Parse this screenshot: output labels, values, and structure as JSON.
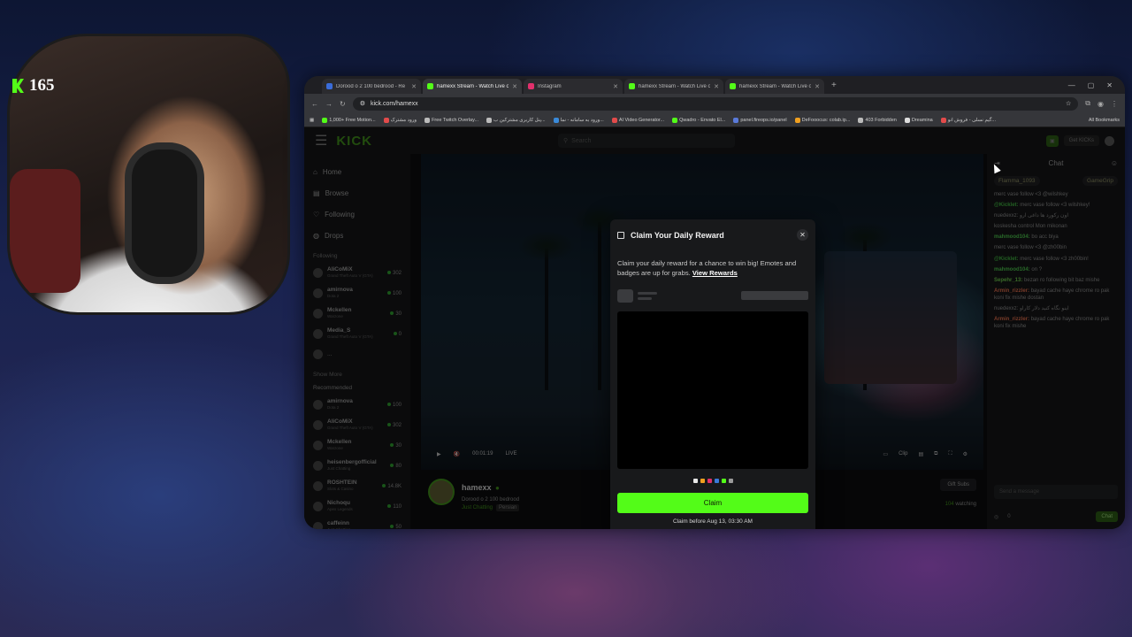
{
  "overlay": {
    "counter_value": "165",
    "counter_color": "#53fc18"
  },
  "browser": {
    "tabs": [
      {
        "title": "Dorood o 2 100 bedrood - Re",
        "fav": "#3a6cd9"
      },
      {
        "title": "hamexx Stream - Watch Live o",
        "fav": "#53fc18",
        "active": true
      },
      {
        "title": "Instagram",
        "fav": "#e1306c"
      },
      {
        "title": "hamexx Stream - Watch Live o",
        "fav": "#53fc18"
      },
      {
        "title": "hamexx Stream - Watch Live o",
        "fav": "#53fc18"
      }
    ],
    "url": "kick.com/hamexx",
    "bookmarks": [
      {
        "label": "1,000+ Free Motion...",
        "fav": "#53fc18"
      },
      {
        "label": "ورود مشترک",
        "fav": "#e24b4b"
      },
      {
        "label": "Free Twitch Overlay...",
        "fav": "#bbb"
      },
      {
        "label": "پنل کاربری مشترکین ب...",
        "fav": "#bbb"
      },
      {
        "label": "ورود به سامانه - نما...",
        "fav": "#3a8ad9"
      },
      {
        "label": "AI Video Generator...",
        "fav": "#e24b4b"
      },
      {
        "label": "Qwadro - Envato El...",
        "fav": "#53fc18"
      },
      {
        "label": "panel.fireops.io/panel",
        "fav": "#5a7ad9"
      },
      {
        "label": "DeFooocus: colab.ip...",
        "fav": "#f0a020"
      },
      {
        "label": "403 Forbidden",
        "fav": "#bbb"
      },
      {
        "label": "Dreamina",
        "fav": "#ddd"
      },
      {
        "label": "گیم نسلی - فروش انو...",
        "fav": "#e24b4b"
      }
    ],
    "all_bookmarks": "All Bookmarks"
  },
  "kick": {
    "logo": "KICK",
    "search_placeholder": "Search",
    "get_kicks": "Get KICKs",
    "nav": [
      {
        "label": "Home",
        "icon": "home-icon",
        "glyph": "⌂"
      },
      {
        "label": "Browse",
        "icon": "browse-icon",
        "glyph": "▤"
      },
      {
        "label": "Following",
        "icon": "heart-icon",
        "glyph": "♡"
      },
      {
        "label": "Drops",
        "icon": "drops-icon",
        "glyph": "◍"
      }
    ],
    "following_header": "Following",
    "following": [
      {
        "name": "AliCoMiX",
        "sub": "Grand Theft Auto V (GTA)",
        "viewers": "302"
      },
      {
        "name": "amirnova",
        "sub": "Dota 2",
        "viewers": "100"
      },
      {
        "name": "Mckellen",
        "sub": "Warzone",
        "viewers": "30"
      },
      {
        "name": "Media_S",
        "sub": "Grand Theft Auto V (GTA)",
        "viewers": "0"
      }
    ],
    "show_more": "Show More",
    "recommended_header": "Recommended",
    "recommended": [
      {
        "name": "amirnova",
        "sub": "Dota 2",
        "viewers": "100"
      },
      {
        "name": "AliCoMiX",
        "sub": "Grand Theft Auto V (GTA)",
        "viewers": "302"
      },
      {
        "name": "Mckellen",
        "sub": "Warzone",
        "viewers": "30"
      },
      {
        "name": "heisenbergofficial",
        "sub": "Just Chatting",
        "viewers": "80"
      },
      {
        "name": "ROSHTEIN",
        "sub": "Slots & Casino",
        "viewers": "14.8K"
      },
      {
        "name": "Nichoqu",
        "sub": "Apex Legends",
        "viewers": "110"
      },
      {
        "name": "caffeinn",
        "sub": "Just Chatting",
        "viewers": "50"
      }
    ],
    "player": {
      "time": "00:01:19",
      "live": "LIVE",
      "clip": "Clip"
    },
    "streamer": {
      "name": "hamexx",
      "title": "Dorood o 2 100 bedrood",
      "category": "Just Chatting",
      "tag": "Persian",
      "gift_subs": "Gift Subs",
      "watching_count": "104",
      "watching_label": "watching"
    },
    "chat": {
      "title": "Chat",
      "gifters": [
        "Flamma_1093",
        "GameGrip"
      ],
      "messages": [
        {
          "user": "",
          "text": "merc vase follow <3 @wilshkey",
          "color": "#d94a4a"
        },
        {
          "user": "@Kicklet:",
          "text": "merc vase follow <3 wilshkey!",
          "color": "#3fae3f"
        },
        {
          "user": "",
          "text": "nuedexxz: اون رکورد ها داغی ارو",
          "color": "#8a8a8a"
        },
        {
          "user": "",
          "text": "koskesha control Mon mikonan",
          "color": "#d94a4a"
        },
        {
          "user": "mahmood104:",
          "text": "bo acc biya",
          "color": "#4abf4a"
        },
        {
          "user": "",
          "text": "merc vase follow <3 @zh00bin",
          "color": "#d94a4a"
        },
        {
          "user": "@Kicklet:",
          "text": "merc vase follow <3 zh00bin!",
          "color": "#3fae3f"
        },
        {
          "user": "mahmood104:",
          "text": "on ?",
          "color": "#4abf4a"
        },
        {
          "user": "Sepehr_13:",
          "text": "bezan ro following bit baz mishe",
          "color": "#6ac24a"
        },
        {
          "user": "Armin_rizzler:",
          "text": "bayad cache haye chrome ro pak koni fix mishe dostan",
          "color": "#d96a4a"
        },
        {
          "user": "",
          "text": "nuedexxz: اینو نگاه کنید دلار کاراو",
          "color": "#8a8a8a"
        },
        {
          "user": "Armin_rizzler:",
          "text": "bayad cache haye chrome ro pak koni fix mishe",
          "color": "#d96a4a"
        }
      ],
      "send_placeholder": "Send a message",
      "chat_button": "Chat",
      "points": "0"
    }
  },
  "modal": {
    "title": "Claim Your Daily Reward",
    "description": "Claim your daily reward for a chance to win big! Emotes and badges are up for grabs.",
    "view_rewards": "View Rewards",
    "claim_label": "Claim",
    "claim_before": "Claim before Aug 13, 03:30 AM",
    "accent": "#53fc18",
    "dot_colors": [
      "#e8e8e8",
      "#f0a020",
      "#e0306a",
      "#3a7ad9",
      "#53fc18",
      "#9a9a9a"
    ]
  }
}
